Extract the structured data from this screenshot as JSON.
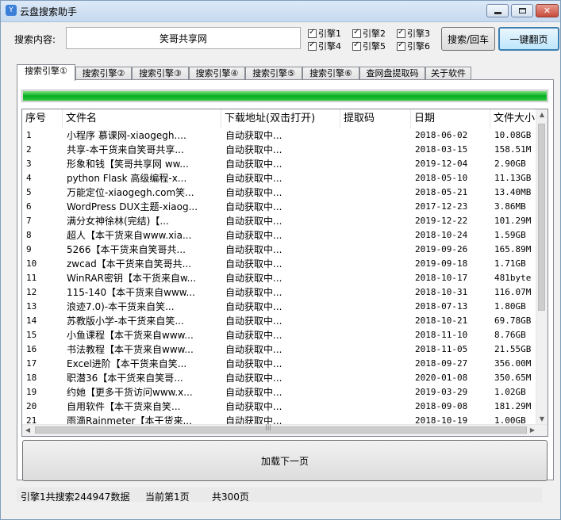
{
  "window": {
    "title": "云盘搜索助手",
    "app_icon": "Y"
  },
  "search": {
    "label": "搜索内容:",
    "value": "笑哥共享网"
  },
  "engines": [
    {
      "label": "引擎1",
      "checked": true
    },
    {
      "label": "引擎2",
      "checked": true
    },
    {
      "label": "引擎3",
      "checked": true
    },
    {
      "label": "引擎4",
      "checked": true
    },
    {
      "label": "引擎5",
      "checked": true
    },
    {
      "label": "引擎6",
      "checked": true
    }
  ],
  "buttons": {
    "search": "搜索/回车",
    "page_all": "一键翻页",
    "load_next": "加载下一页"
  },
  "tabs": [
    "搜索引擎①",
    "搜索引擎②",
    "搜索引擎③",
    "搜索引擎④",
    "搜索引擎⑤",
    "搜索引擎⑥",
    "查网盘提取码",
    "关于软件"
  ],
  "progress": {
    "percent": 100
  },
  "table": {
    "headers": [
      "序号",
      "文件名",
      "下载地址(双击打开)",
      "提取码",
      "日期",
      "文件大小"
    ],
    "rows": [
      [
        "1",
        "小程序 慕课网-xiaogegh....",
        "自动获取中...",
        "",
        "2018-06-02",
        "10.08GB"
      ],
      [
        "2",
        "共享-本干货来自笑哥共享...",
        "自动获取中...",
        "",
        "2018-03-15",
        "158.51M"
      ],
      [
        "3",
        "形象和钱【笑哥共享网 ww...",
        "自动获取中...",
        "",
        "2019-12-04",
        "2.90GB"
      ],
      [
        "4",
        "python Flask 高级编程-x...",
        "自动获取中...",
        "",
        "2018-05-10",
        "11.13GB"
      ],
      [
        "5",
        "万能定位-xiaogegh.com笑...",
        "自动获取中...",
        "",
        "2018-05-21",
        "13.40MB"
      ],
      [
        "6",
        "WordPress DUX主题-xiaog...",
        "自动获取中...",
        "",
        "2017-12-23",
        "3.86MB"
      ],
      [
        "7",
        "满分女神徐林(完结)【...",
        "自动获取中...",
        "",
        "2019-12-22",
        "101.29M"
      ],
      [
        "8",
        "超人【本干货来自www.xia...",
        "自动获取中...",
        "",
        "2018-10-24",
        "1.59GB"
      ],
      [
        "9",
        "5266【本干货来自笑哥共...",
        "自动获取中...",
        "",
        "2019-09-26",
        "165.89M"
      ],
      [
        "10",
        "zwcad【本干货来自笑哥共...",
        "自动获取中...",
        "",
        "2019-09-18",
        "1.71GB"
      ],
      [
        "11",
        "WinRAR密钥【本干货来自w...",
        "自动获取中...",
        "",
        "2018-10-17",
        "481byte"
      ],
      [
        "12",
        "115-140【本干货来自www...",
        "自动获取中...",
        "",
        "2018-10-31",
        "116.07M"
      ],
      [
        "13",
        "浪迹7.0)-本干货来自笑...",
        "自动获取中...",
        "",
        "2018-07-13",
        "1.80GB"
      ],
      [
        "14",
        "苏教版小学-本干货来自笑...",
        "自动获取中...",
        "",
        "2018-10-21",
        "69.78GB"
      ],
      [
        "15",
        "小鱼课程【本干货来自www...",
        "自动获取中...",
        "",
        "2018-11-10",
        "8.76GB"
      ],
      [
        "16",
        "书法教程【本干货来自www...",
        "自动获取中...",
        "",
        "2018-11-05",
        "21.55GB"
      ],
      [
        "17",
        "Excel进阶【本干货来自笑...",
        "自动获取中...",
        "",
        "2018-09-27",
        "356.00M"
      ],
      [
        "18",
        "职潜36【本干货来自笑哥...",
        "自动获取中...",
        "",
        "2020-01-08",
        "350.65M"
      ],
      [
        "19",
        "约她【更多干货访问www.x...",
        "自动获取中...",
        "",
        "2019-03-29",
        "1.02GB"
      ],
      [
        "20",
        "自用软件【本干货来自笑...",
        "自动获取中...",
        "",
        "2018-09-08",
        "181.29M"
      ],
      [
        "21",
        "雨滴Rainmeter【本干货来...",
        "自动获取中...",
        "",
        "2018-10-19",
        "1.00GB"
      ]
    ]
  },
  "status": {
    "total": "引擎1共搜索244947数据",
    "current_page": "当前第1页",
    "total_pages": "共300页"
  },
  "colors": {
    "progress": "#06b025",
    "titlebar": "#c6d9ef",
    "close": "#c74b3c"
  }
}
